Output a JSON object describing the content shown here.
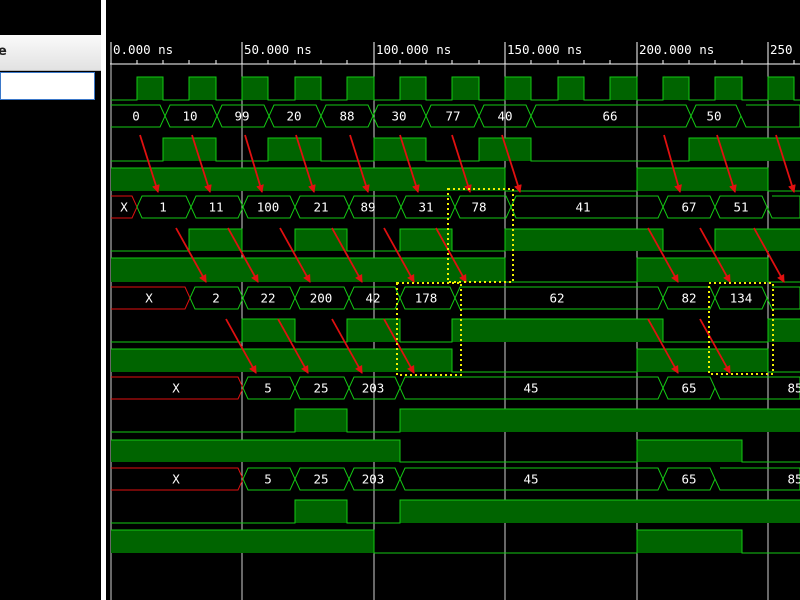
{
  "names_pane": {
    "header_label": "e"
  },
  "waveform": {
    "ruler": {
      "ticks": [
        "0.000 ns",
        "50.000 ns",
        "100.000 ns",
        "150.000 ns",
        "200.000 ns",
        "250"
      ]
    },
    "colors": {
      "background": "#000000",
      "signal": "#14c814",
      "fill": "#006400",
      "undefined": "#e01010",
      "arrow": "#e01010",
      "highlight": "#f0f000",
      "grid": "#d0d0d0"
    },
    "buses": [
      {
        "id": "bus0",
        "values": [
          "0",
          "10",
          "99",
          "20",
          "88",
          "30",
          "77",
          "40",
          "66",
          "50"
        ]
      },
      {
        "id": "bus1",
        "values": [
          "X",
          "1",
          "11",
          "100",
          "21",
          "89",
          "31",
          "78",
          "41",
          "67",
          "51"
        ]
      },
      {
        "id": "bus2",
        "values": [
          "X",
          "2",
          "22",
          "200",
          "42",
          "178",
          "62",
          "82",
          "134"
        ]
      },
      {
        "id": "bus3",
        "values": [
          "X",
          "5",
          "25",
          "203",
          "45",
          "65",
          "85"
        ]
      },
      {
        "id": "bus4",
        "values": [
          "X",
          "5",
          "25",
          "203",
          "45",
          "65",
          "85"
        ]
      }
    ]
  }
}
